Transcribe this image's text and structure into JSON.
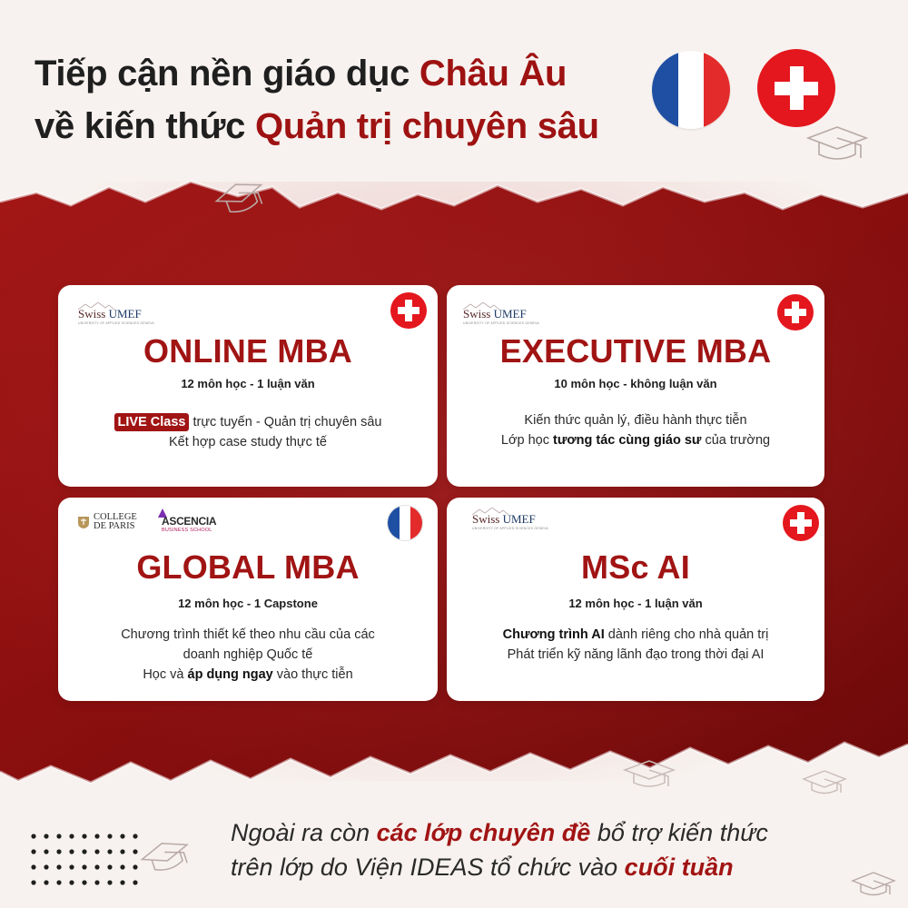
{
  "header": {
    "line1_prefix": "Tiếp cận nền giáo dục ",
    "line1_highlight": "Châu Âu",
    "line2_prefix": "về kiến thức ",
    "line2_highlight": "Quản trị chuyên sâu"
  },
  "flags": {
    "france": [
      "#1f4fa3",
      "#ffffff",
      "#e32b2b"
    ],
    "switzerland": "#e4171e"
  },
  "cards": [
    {
      "logo": {
        "swiss": "Swiss",
        "umef": "UMEF",
        "tagline": "UNIVERSITY OF APPLIED SCIENCES GENEVA"
      },
      "title": "ONLINE MBA",
      "subtitle": "12 môn học - 1 luận văn",
      "badge": "LIVE Class",
      "line1": " trực tuyến - Quản trị chuyên sâu",
      "line2": "Kết hợp case study thực tế",
      "flag": "switzerland"
    },
    {
      "logo": {
        "swiss": "Swiss",
        "umef": "UMEF",
        "tagline": "UNIVERSITY OF APPLIED SCIENCES GENEVA"
      },
      "title": "EXECUTIVE MBA",
      "subtitle": "10 môn học - không luận văn",
      "line1": "Kiến thức quản lý, điều hành thực tiễn",
      "line2_prefix": "Lớp học ",
      "line2_bold": "tương tác cùng giáo sư",
      "line2_suffix": " của trường",
      "flag": "switzerland"
    },
    {
      "logo_cdp_1": "COLLEGE",
      "logo_cdp_2": "DE PARIS",
      "logo_asc": "ASCENCIA",
      "logo_asc_sub": "BUSINESS SCHOOL",
      "title": "GLOBAL MBA",
      "subtitle": "12 môn học - 1 Capstone",
      "line1": "Chương trình thiết kế theo nhu cầu của các",
      "line2": "doanh nghiệp Quốc tế",
      "line3_prefix": "Học và ",
      "line3_bold": "áp dụng ngay",
      "line3_suffix": " vào thực tiễn",
      "flag": "france"
    },
    {
      "logo": {
        "swiss": "Swiss",
        "umef": "UMEF",
        "tagline": "UNIVERSITY OF APPLIED SCIENCES GENEVA"
      },
      "title": "MSc AI",
      "subtitle": "12 môn học - 1 luận văn",
      "line1_bold": "Chương trình AI",
      "line1_suffix": " dành riêng cho nhà quản trị",
      "line2": "Phát triển kỹ năng lãnh đạo trong thời đại AI",
      "flag": "switzerland"
    }
  ],
  "footer": {
    "line1_prefix": "Ngoài ra còn ",
    "line1_em": "các lớp chuyên đề",
    "line1_suffix": " bổ trợ kiến thức",
    "line2_prefix": "trên lớp do Viện IDEAS  tổ chức vào ",
    "line2_em": "cuối tuần"
  },
  "colors": {
    "accent": "#a11414",
    "band": "#8e1010",
    "background": "#f7f2ef"
  }
}
